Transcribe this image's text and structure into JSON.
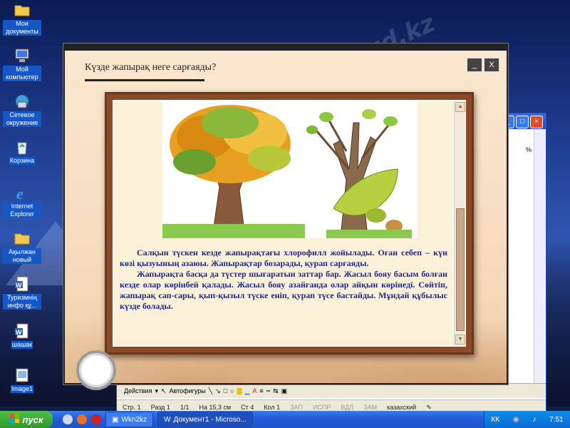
{
  "desktop": {
    "icons": [
      {
        "label": "Мои документы",
        "icon": "folder-icon"
      },
      {
        "label": "Мой компьютер",
        "icon": "computer-icon"
      },
      {
        "label": "Сетевое окружение",
        "icon": "network-icon"
      },
      {
        "label": "Корзина",
        "icon": "recycle-bin-icon"
      },
      {
        "label": "Internet Explorer",
        "icon": "ie-icon"
      },
      {
        "label": "Ақылжан новый",
        "icon": "folder-icon"
      },
      {
        "label": "Туризмнің инфо құ...",
        "icon": "word-doc-icon"
      },
      {
        "label": "шашак",
        "icon": "word-doc-icon"
      },
      {
        "label": "Image1",
        "icon": "image-icon"
      }
    ],
    "watermark": "Stud.kz"
  },
  "app": {
    "title": "Күзде жапырақ неге сарғаяды?",
    "minimize_glyph": "_",
    "close_glyph": "X",
    "paragraph1": "Салқын түскен кезде жапырақтағы хлорофилл жойылады. Оған себеп – күн көзі қызуының азаюы. Жапырақтар бозарады, қурап сарғаяды.",
    "paragraph2": "Жапырақта басқа да түстер шығаратын заттар бар. Жасыл бояу басым болған кезде олар көрінбей қалады. Жасыл бояу азайғанда олар айқын көрінеді. Сөйтіп, жапырақ сап-сары, қып-қызыл түске еніп, қурап түсе бастайды. Мұндай құбылыс күзде болады."
  },
  "word": {
    "zoom": "%",
    "toolbar": {
      "actions": "Действия",
      "autoshapes": "Автофигуры"
    },
    "status": {
      "page": "Стр. 1",
      "section": "Разд 1",
      "pages": "1/1",
      "position": "На 15,3 см",
      "line": "Ст 4",
      "col": "Кол 1",
      "rec": "ЗАП",
      "trk": "ИСПР",
      "ext": "ВДЛ",
      "ovr": "ЗАМ",
      "lang": "казахский"
    }
  },
  "taskbar": {
    "start": "пуск",
    "tasks": [
      "Wkn2kz",
      "Документ1 - Microso..."
    ],
    "lang": "КК",
    "time": "7:51"
  }
}
